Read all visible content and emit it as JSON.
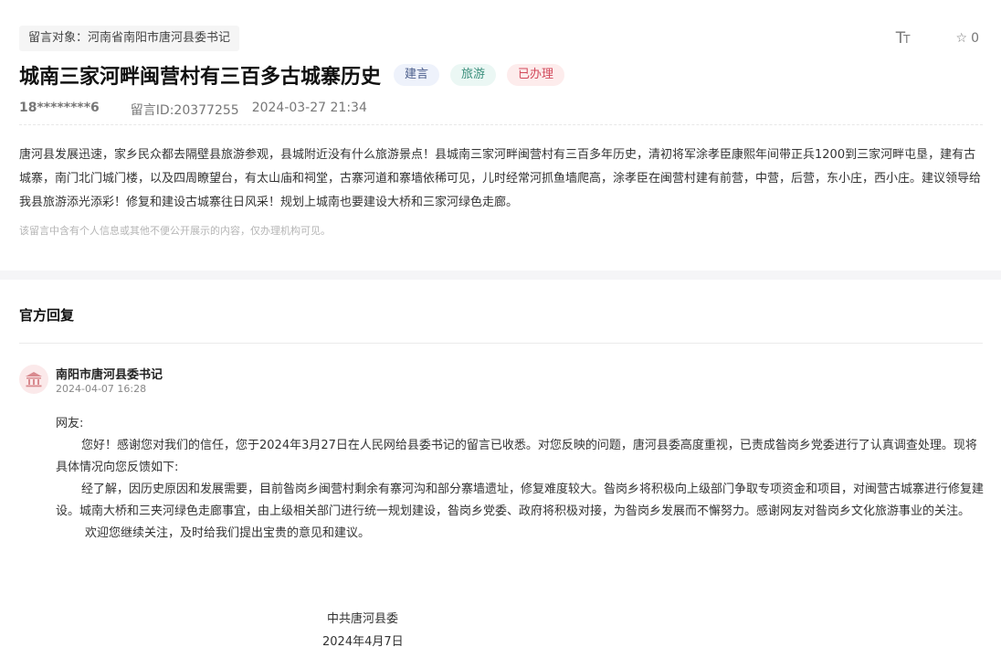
{
  "message": {
    "target_label": "留言对象：河南省南阳市唐河县委书记",
    "font_size_icon_label": "TT",
    "favorite_count": "0",
    "title": "城南三家河畔闽营村有三百多古城寨历史",
    "badges": [
      "建言",
      "旅游",
      "已办理"
    ],
    "author": "18********6",
    "message_id": "留言ID:20377255",
    "time": "2024-03-27 21:34",
    "content": "唐河县发展迅速，家乡民众都去隔壁县旅游参观，县城附近没有什么旅游景点！县城南三家河畔闽营村有三百多年历史，清初将军涂孝臣康熙年间带正兵1200到三家河畔屯垦，建有古城寨，南门北门城门楼，以及四周瞭望台，有太山庙和祠堂，古寨河道和寨墙依稀可见，儿时经常河抓鱼墙爬高，涂孝臣在闽营村建有前营，中营，后营，东小庄，西小庄。建议领导给我县旅游添光添彩！修复和建设古城寨往日风采！规划上城南也要建设大桥和三家河绿色走廊。",
    "notice": "该留言中含有个人信息或其他不便公开展示的内容，仅办理机构可见。"
  },
  "reply": {
    "heading": "官方回复",
    "org_name": "南阳市唐河县委书记",
    "time": "2024-04-07 16:28",
    "greeting": "网友:",
    "paragraphs": [
      "您好！感谢您对我们的信任，您于2024年3月27日在人民网给县委书记的留言已收悉。对您反映的问题，唐河县委高度重视，已责成昝岗乡党委进行了认真调查处理。现将具体情况向您反馈如下:",
      "经了解，因历史原因和发展需要，目前昝岗乡闽营村剩余有寨河沟和部分寨墙遗址，修复难度较大。昝岗乡将积极向上级部门争取专项资金和项目，对闽营古城寨进行修复建设。城南大桥和三夹河绿色走廊事宜，由上级相关部门进行统一规划建设，昝岗乡党委、政府将积极对接，为昝岗乡发展而不懈努力。感谢网友对昝岗乡文化旅游事业的关注。",
      "欢迎您继续关注，及时给我们提出宝贵的意见和建议。"
    ],
    "sign_org": "中共唐河县委",
    "sign_date": "2024年4月7日"
  }
}
